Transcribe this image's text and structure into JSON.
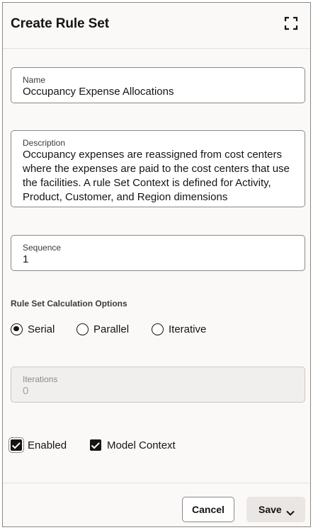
{
  "header": {
    "title": "Create Rule Set",
    "expand_icon": "expand-corners-icon"
  },
  "form": {
    "name": {
      "label": "Name",
      "value": "Occupancy Expense Allocations"
    },
    "description": {
      "label": "Description",
      "value": "Occupancy expenses are reassigned from cost centers where the expenses are paid to the cost centers that use the facilities. A rule Set Context is defined for Activity, Product, Customer, and Region dimensions"
    },
    "sequence": {
      "label": "Sequence",
      "value": "1"
    },
    "calculation_options": {
      "label": "Rule Set Calculation Options",
      "selected": "Serial",
      "options": [
        {
          "label": "Serial",
          "checked": true
        },
        {
          "label": "Parallel",
          "checked": false
        },
        {
          "label": "Iterative",
          "checked": false
        }
      ]
    },
    "iterations": {
      "label": "Iterations",
      "value": "0",
      "disabled": true
    },
    "enabled": {
      "label": "Enabled",
      "checked": true
    },
    "model_context": {
      "label": "Model Context",
      "checked": true
    }
  },
  "footer": {
    "cancel_label": "Cancel",
    "save_label": "Save",
    "save_dropdown_icon": "chevron-down-icon"
  }
}
